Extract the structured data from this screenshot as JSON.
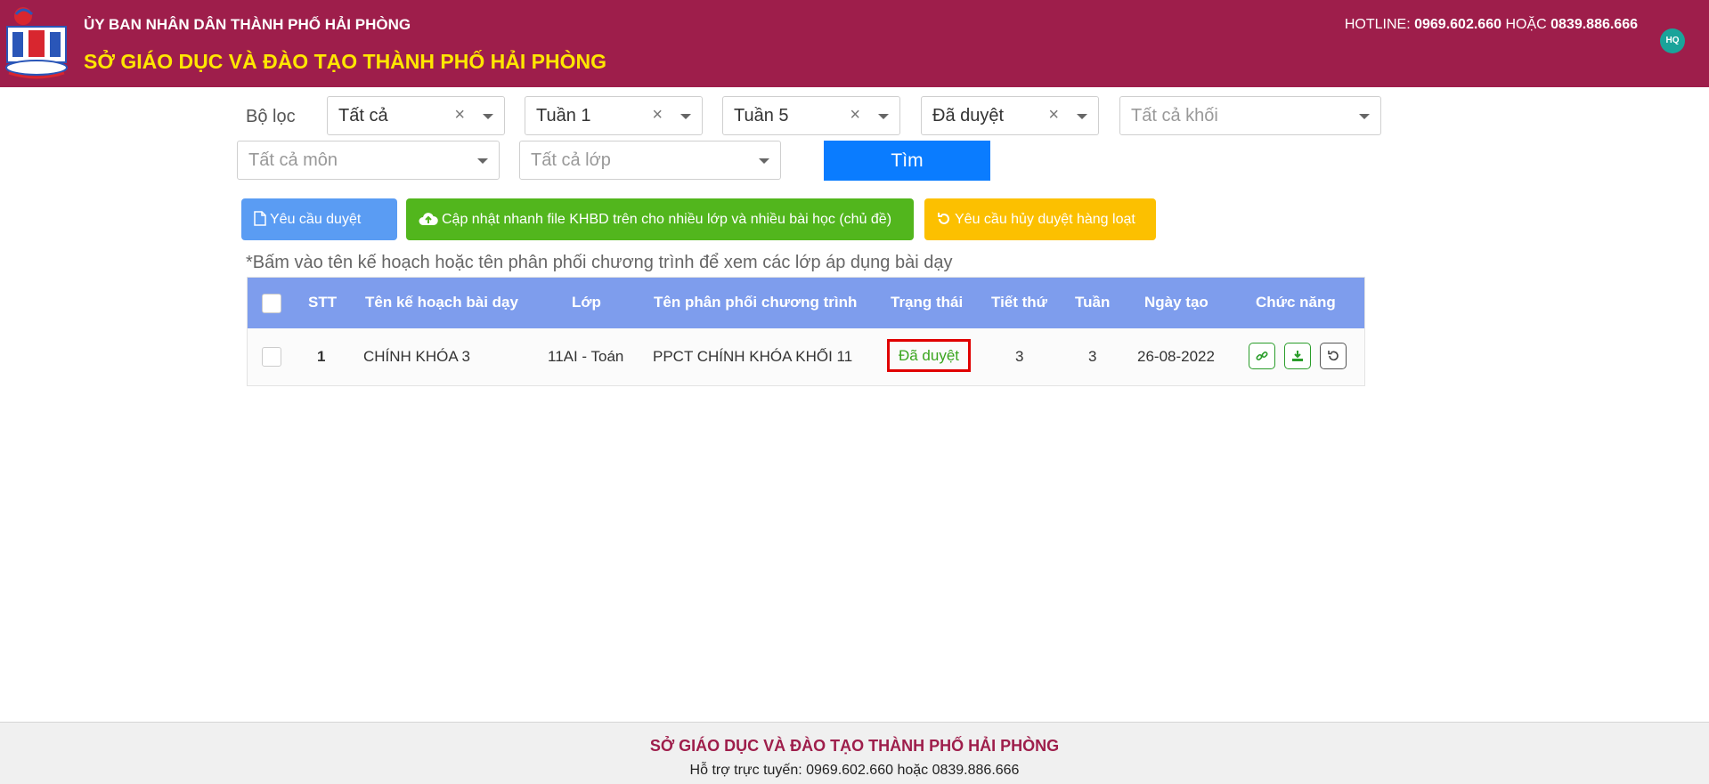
{
  "header": {
    "org": "ỦY BAN NHÂN DÂN THÀNH PHỐ HẢI PHÒNG",
    "dept": "SỞ GIÁO DỤC VÀ ĐÀO TẠO THÀNH PHỐ HẢI PHÒNG",
    "hotline_label": "HOTLINE:",
    "hotline_1": "0969.602.660",
    "hotline_or": "HOẶC",
    "hotline_2": "0839.886.666",
    "avatar": "HQ"
  },
  "filters": {
    "label": "Bộ lọc",
    "type": "Tất cả",
    "week_from": "Tuần 1",
    "week_to": "Tuần 5",
    "status": "Đã duyệt",
    "grade_placeholder": "Tất cả khối",
    "subject_placeholder": "Tất cả môn",
    "class_placeholder": "Tất cả lớp",
    "clear_symbol": "×",
    "search_label": "Tìm"
  },
  "actions": {
    "request_approval": "Yêu cầu duyệt",
    "bulk_update": "Cập nhật nhanh file KHBD trên cho nhiều lớp và nhiều bài học (chủ đề)",
    "bulk_cancel": "Yêu cầu hủy duyệt hàng loạt"
  },
  "note": "*Bấm vào tên kế hoạch hoặc tên phân phối chương trình để xem các lớp áp dụng bài dạy",
  "table": {
    "headers": {
      "stt": "STT",
      "plan": "Tên kế hoạch bài dạy",
      "class": "Lớp",
      "program": "Tên phân phối chương trình",
      "status": "Trạng thái",
      "period": "Tiết thứ",
      "week": "Tuần",
      "created": "Ngày tạo",
      "actions": "Chức năng"
    },
    "rows": [
      {
        "stt": "1",
        "plan": "CHÍNH KHÓA 3",
        "class": "11AI - Toán",
        "program": "PPCT CHÍNH KHÓA KHỐI 11",
        "status": "Đã duyệt",
        "period": "3",
        "week": "3",
        "created": "26-08-2022"
      }
    ]
  },
  "footer": {
    "title": "SỞ GIÁO DỤC VÀ ĐÀO TẠO THÀNH PHỐ HẢI PHÒNG",
    "support": "Hỗ trợ trực tuyến: 0969.602.660 hoặc 0839.886.666"
  },
  "colors": {
    "header_bg": "#9e1e4b",
    "dept_text": "#ffe600",
    "search_button": "#0a7cff",
    "table_header": "#7e9ded",
    "status_text": "#3aa51e",
    "status_outline": "#e00000"
  }
}
